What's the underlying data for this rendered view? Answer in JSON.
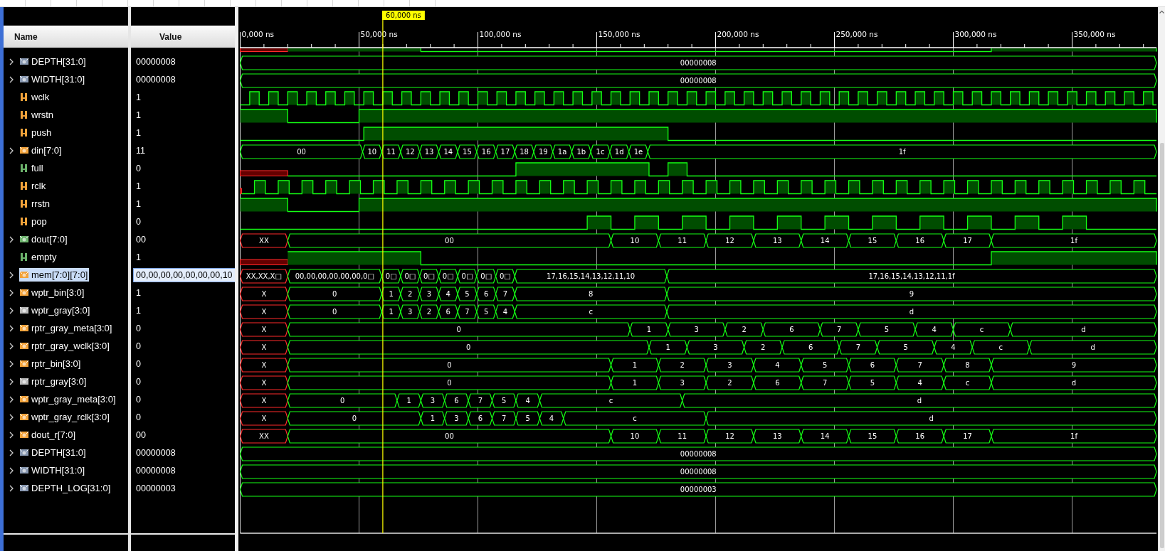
{
  "columns": [
    {
      "label": "Name"
    },
    {
      "label": "Value"
    }
  ],
  "timeline": {
    "ticks": [
      {
        "label": "0,000 ns"
      },
      {
        "label": "50,000 ns"
      },
      {
        "label": "100,000 ns"
      },
      {
        "label": "150,000 ns"
      },
      {
        "label": "200,000 ns"
      },
      {
        "label": "250,000 ns"
      },
      {
        "label": "300,000 ns"
      },
      {
        "label": "350,000 ns"
      }
    ],
    "cursor": {
      "label": "60,000 ns"
    }
  },
  "partial_row": {
    "kind": "bit"
  },
  "rows": [
    {
      "name": "DEPTH[31:0]",
      "value": "00000008",
      "kind": "bus",
      "color": "#8797b0",
      "selected": false,
      "segments": [
        {
          "value": "00000008",
          "unknown": false
        }
      ]
    },
    {
      "name": "WIDTH[31:0]",
      "value": "00000008",
      "kind": "bus",
      "color": "#8797b0",
      "selected": false,
      "segments": [
        {
          "value": "00000008",
          "unknown": false
        }
      ]
    },
    {
      "name": "wclk",
      "value": "1",
      "kind": "clock",
      "color": "#f2a23a",
      "selected": false
    },
    {
      "name": "wrstn",
      "value": "1",
      "kind": "bit",
      "color": "#f2a23a",
      "selected": false
    },
    {
      "name": "push",
      "value": "1",
      "kind": "bit",
      "color": "#f2a23a",
      "selected": false
    },
    {
      "name": "din[7:0]",
      "value": "11",
      "kind": "bus",
      "color": "#f2a23a",
      "selected": false,
      "segments": [
        {
          "value": "00",
          "unknown": false
        },
        {
          "value": "10",
          "unknown": false
        },
        {
          "value": "11",
          "unknown": false
        },
        {
          "value": "12",
          "unknown": false
        },
        {
          "value": "13",
          "unknown": false
        },
        {
          "value": "14",
          "unknown": false
        },
        {
          "value": "15",
          "unknown": false
        },
        {
          "value": "16",
          "unknown": false
        },
        {
          "value": "17",
          "unknown": false
        },
        {
          "value": "18",
          "unknown": false
        },
        {
          "value": "19",
          "unknown": false
        },
        {
          "value": "1a",
          "unknown": false
        },
        {
          "value": "1b",
          "unknown": false
        },
        {
          "value": "1c",
          "unknown": false
        },
        {
          "value": "1d",
          "unknown": false
        },
        {
          "value": "1e",
          "unknown": false
        },
        {
          "value": "1f",
          "unknown": false
        }
      ]
    },
    {
      "name": "full",
      "value": "0",
      "kind": "bit",
      "color": "#6cb36c",
      "selected": false
    },
    {
      "name": "rclk",
      "value": "1",
      "kind": "clock",
      "color": "#f2a23a",
      "selected": false
    },
    {
      "name": "rrstn",
      "value": "1",
      "kind": "bit",
      "color": "#f2a23a",
      "selected": false
    },
    {
      "name": "pop",
      "value": "0",
      "kind": "bit",
      "color": "#f2a23a",
      "selected": false
    },
    {
      "name": "dout[7:0]",
      "value": "00",
      "kind": "bus",
      "color": "#6cb36c",
      "selected": false,
      "segments": [
        {
          "value": "XX",
          "unknown": true
        },
        {
          "value": "00",
          "unknown": false
        },
        {
          "value": "10",
          "unknown": false
        },
        {
          "value": "11",
          "unknown": false
        },
        {
          "value": "12",
          "unknown": false
        },
        {
          "value": "13",
          "unknown": false
        },
        {
          "value": "14",
          "unknown": false
        },
        {
          "value": "15",
          "unknown": false
        },
        {
          "value": "16",
          "unknown": false
        },
        {
          "value": "17",
          "unknown": false
        },
        {
          "value": "1f",
          "unknown": false
        }
      ]
    },
    {
      "name": "empty",
      "value": "1",
      "kind": "bit",
      "color": "#6cb36c",
      "selected": false
    },
    {
      "name": "mem[7:0][7:0]",
      "value": "00,00,00,00,00,00,00,10",
      "kind": "bus",
      "color": "#f2a23a",
      "selected": true,
      "segments": [
        {
          "value": "XX,XX,X□",
          "unknown": true
        },
        {
          "value": "00,00,00,00,00,00,0□",
          "unknown": false
        },
        {
          "value": "0□",
          "unknown": false
        },
        {
          "value": "0□",
          "unknown": false
        },
        {
          "value": "0□",
          "unknown": false
        },
        {
          "value": "0□",
          "unknown": false
        },
        {
          "value": "0□",
          "unknown": false
        },
        {
          "value": "0□",
          "unknown": false
        },
        {
          "value": "0□",
          "unknown": false
        },
        {
          "value": "17,16,15,14,13,12,11,10",
          "unknown": false
        },
        {
          "value": "17,16,15,14,13,12,11,1f",
          "unknown": false
        }
      ]
    },
    {
      "name": "wptr_bin[3:0]",
      "value": "1",
      "kind": "bus",
      "color": "#f2a23a",
      "selected": false,
      "segments": [
        {
          "value": "X",
          "unknown": true
        },
        {
          "value": "0",
          "unknown": false
        },
        {
          "value": "1",
          "unknown": false
        },
        {
          "value": "2",
          "unknown": false
        },
        {
          "value": "3",
          "unknown": false
        },
        {
          "value": "4",
          "unknown": false
        },
        {
          "value": "5",
          "unknown": false
        },
        {
          "value": "6",
          "unknown": false
        },
        {
          "value": "7",
          "unknown": false
        },
        {
          "value": "8",
          "unknown": false
        },
        {
          "value": "9",
          "unknown": false
        }
      ]
    },
    {
      "name": "wptr_gray[3:0]",
      "value": "1",
      "kind": "bus",
      "color": "#b8b8b8",
      "selected": false,
      "segments": [
        {
          "value": "X",
          "unknown": true
        },
        {
          "value": "0",
          "unknown": false
        },
        {
          "value": "1",
          "unknown": false
        },
        {
          "value": "3",
          "unknown": false
        },
        {
          "value": "2",
          "unknown": false
        },
        {
          "value": "6",
          "unknown": false
        },
        {
          "value": "7",
          "unknown": false
        },
        {
          "value": "5",
          "unknown": false
        },
        {
          "value": "4",
          "unknown": false
        },
        {
          "value": "c",
          "unknown": false
        },
        {
          "value": "d",
          "unknown": false
        }
      ]
    },
    {
      "name": "rptr_gray_meta[3:0]",
      "value": "0",
      "kind": "bus",
      "color": "#f2a23a",
      "selected": false,
      "segments": [
        {
          "value": "X",
          "unknown": true
        },
        {
          "value": "0",
          "unknown": false
        },
        {
          "value": "1",
          "unknown": false
        },
        {
          "value": "3",
          "unknown": false
        },
        {
          "value": "2",
          "unknown": false
        },
        {
          "value": "6",
          "unknown": false
        },
        {
          "value": "7",
          "unknown": false
        },
        {
          "value": "5",
          "unknown": false
        },
        {
          "value": "4",
          "unknown": false
        },
        {
          "value": "c",
          "unknown": false
        },
        {
          "value": "d",
          "unknown": false
        }
      ]
    },
    {
      "name": "rptr_gray_wclk[3:0]",
      "value": "0",
      "kind": "bus",
      "color": "#f2a23a",
      "selected": false,
      "segments": [
        {
          "value": "X",
          "unknown": true
        },
        {
          "value": "0",
          "unknown": false
        },
        {
          "value": "1",
          "unknown": false
        },
        {
          "value": "3",
          "unknown": false
        },
        {
          "value": "2",
          "unknown": false
        },
        {
          "value": "6",
          "unknown": false
        },
        {
          "value": "7",
          "unknown": false
        },
        {
          "value": "5",
          "unknown": false
        },
        {
          "value": "4",
          "unknown": false
        },
        {
          "value": "c",
          "unknown": false
        },
        {
          "value": "d",
          "unknown": false
        }
      ]
    },
    {
      "name": "rptr_bin[3:0]",
      "value": "0",
      "kind": "bus",
      "color": "#f2a23a",
      "selected": false,
      "segments": [
        {
          "value": "X",
          "unknown": true
        },
        {
          "value": "0",
          "unknown": false
        },
        {
          "value": "1",
          "unknown": false
        },
        {
          "value": "2",
          "unknown": false
        },
        {
          "value": "3",
          "unknown": false
        },
        {
          "value": "4",
          "unknown": false
        },
        {
          "value": "5",
          "unknown": false
        },
        {
          "value": "6",
          "unknown": false
        },
        {
          "value": "7",
          "unknown": false
        },
        {
          "value": "8",
          "unknown": false
        },
        {
          "value": "9",
          "unknown": false
        }
      ]
    },
    {
      "name": "rptr_gray[3:0]",
      "value": "0",
      "kind": "bus",
      "color": "#b8b8b8",
      "selected": false,
      "segments": [
        {
          "value": "X",
          "unknown": true
        },
        {
          "value": "0",
          "unknown": false
        },
        {
          "value": "1",
          "unknown": false
        },
        {
          "value": "3",
          "unknown": false
        },
        {
          "value": "2",
          "unknown": false
        },
        {
          "value": "6",
          "unknown": false
        },
        {
          "value": "7",
          "unknown": false
        },
        {
          "value": "5",
          "unknown": false
        },
        {
          "value": "4",
          "unknown": false
        },
        {
          "value": "c",
          "unknown": false
        },
        {
          "value": "d",
          "unknown": false
        }
      ]
    },
    {
      "name": "wptr_gray_meta[3:0]",
      "value": "0",
      "kind": "bus",
      "color": "#f2a23a",
      "selected": false,
      "segments": [
        {
          "value": "X",
          "unknown": true
        },
        {
          "value": "0",
          "unknown": false
        },
        {
          "value": "1",
          "unknown": false
        },
        {
          "value": "3",
          "unknown": false
        },
        {
          "value": "6",
          "unknown": false
        },
        {
          "value": "7",
          "unknown": false
        },
        {
          "value": "5",
          "unknown": false
        },
        {
          "value": "4",
          "unknown": false
        },
        {
          "value": "c",
          "unknown": false
        },
        {
          "value": "d",
          "unknown": false
        }
      ]
    },
    {
      "name": "wptr_gray_rclk[3:0]",
      "value": "0",
      "kind": "bus",
      "color": "#f2a23a",
      "selected": false,
      "segments": [
        {
          "value": "X",
          "unknown": true
        },
        {
          "value": "0",
          "unknown": false
        },
        {
          "value": "1",
          "unknown": false
        },
        {
          "value": "3",
          "unknown": false
        },
        {
          "value": "6",
          "unknown": false
        },
        {
          "value": "7",
          "unknown": false
        },
        {
          "value": "5",
          "unknown": false
        },
        {
          "value": "4",
          "unknown": false
        },
        {
          "value": "c",
          "unknown": false
        },
        {
          "value": "d",
          "unknown": false
        }
      ]
    },
    {
      "name": "dout_r[7:0]",
      "value": "00",
      "kind": "bus",
      "color": "#f2a23a",
      "selected": false,
      "segments": [
        {
          "value": "XX",
          "unknown": true
        },
        {
          "value": "00",
          "unknown": false
        },
        {
          "value": "10",
          "unknown": false
        },
        {
          "value": "11",
          "unknown": false
        },
        {
          "value": "12",
          "unknown": false
        },
        {
          "value": "13",
          "unknown": false
        },
        {
          "value": "14",
          "unknown": false
        },
        {
          "value": "15",
          "unknown": false
        },
        {
          "value": "16",
          "unknown": false
        },
        {
          "value": "17",
          "unknown": false
        },
        {
          "value": "1f",
          "unknown": false
        }
      ]
    },
    {
      "name": "DEPTH[31:0]",
      "value": "00000008",
      "kind": "bus",
      "color": "#8797b0",
      "selected": false,
      "segments": [
        {
          "value": "00000008",
          "unknown": false
        }
      ]
    },
    {
      "name": "WIDTH[31:0]",
      "value": "00000008",
      "kind": "bus",
      "color": "#8797b0",
      "selected": false,
      "segments": [
        {
          "value": "00000008",
          "unknown": false
        }
      ]
    },
    {
      "name": "DEPTH_LOG[31:0]",
      "value": "00000003",
      "kind": "bus",
      "color": "#8797b0",
      "selected": false,
      "segments": [
        {
          "value": "00000003",
          "unknown": false
        }
      ]
    }
  ]
}
